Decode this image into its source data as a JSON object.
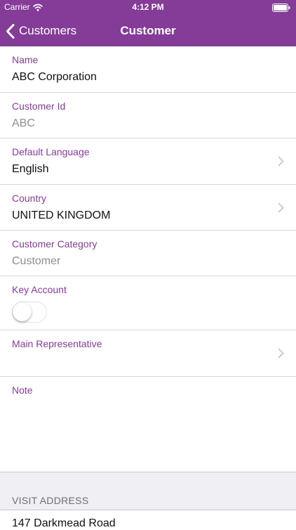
{
  "status_bar": {
    "carrier": "Carrier",
    "time": "4:12 PM"
  },
  "nav": {
    "back_label": "Customers",
    "title": "Customer"
  },
  "fields": {
    "name": {
      "label": "Name",
      "value": "ABC Corporation"
    },
    "customer_id": {
      "label": "Customer Id",
      "value": "ABC"
    },
    "default_language": {
      "label": "Default Language",
      "value": "English"
    },
    "country": {
      "label": "Country",
      "value": "UNITED KINGDOM"
    },
    "customer_category": {
      "label": "Customer Category",
      "value": "Customer"
    },
    "key_account": {
      "label": "Key Account",
      "value": false
    },
    "main_representative": {
      "label": "Main Representative",
      "value": ""
    },
    "note": {
      "label": "Note",
      "value": ""
    }
  },
  "visit_address": {
    "title": "VISIT ADDRESS",
    "line1": "147 Darkmead Road"
  },
  "colors": {
    "accent": "#843c98",
    "separator": "#d8d8d8",
    "readonly_text": "#8e8e93",
    "section_bg": "#efeff4"
  },
  "icons": {
    "back": "chevron-left-icon",
    "disclosure": "chevron-right-icon",
    "wifi": "wifi-icon",
    "battery": "battery-icon"
  }
}
